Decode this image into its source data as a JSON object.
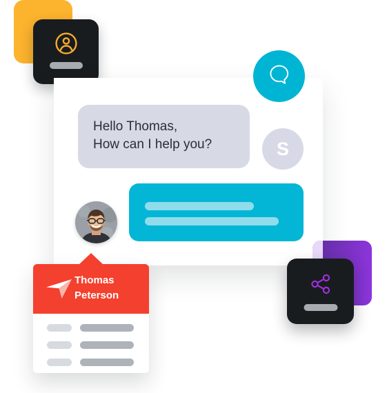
{
  "illustration": {
    "title": "Customer support chat illustration",
    "colors": {
      "yellow": "#fcb32d",
      "dark_card": "#191c1f",
      "cyan": "#00b5d4",
      "cyan_bubble": "#04b6d6",
      "cyan_bubble_line": "#8fdcea",
      "incoming_bubble": "#d7d9e4",
      "incoming_text": "#2b2f36",
      "avatar_circle": "#d7d9e6",
      "red": "#f4402e",
      "purple_dark": "#5e2d9e",
      "purple_light": "#8d35db",
      "purple_tint": "#e9d8f8",
      "panel_white": "#ffffff",
      "bar_gray": "#a7acb1",
      "row_short_gray": "#d7dade",
      "row_long_gray": "#aeb3ba"
    }
  },
  "profile_card": {
    "icon": "user-circle-icon",
    "placeholder_bar": ""
  },
  "chat_badge": {
    "icon": "chat-bubble-icon"
  },
  "chat": {
    "incoming_message": {
      "line1": "Hello Thomas,",
      "line2": "How can I help you?"
    },
    "agent_avatar_initial": "S",
    "outgoing_message": {
      "placeholder_line1": "",
      "placeholder_line2": ""
    },
    "user_avatar": "photo-of-man-with-glasses"
  },
  "notification": {
    "icon": "paper-plane-icon",
    "name_line1": "Thomas",
    "name_line2": "Peterson",
    "rows": [
      {
        "label": "",
        "value": ""
      },
      {
        "label": "",
        "value": ""
      },
      {
        "label": "",
        "value": ""
      }
    ]
  },
  "share_card": {
    "icon": "share-nodes-icon",
    "placeholder_bar": ""
  }
}
